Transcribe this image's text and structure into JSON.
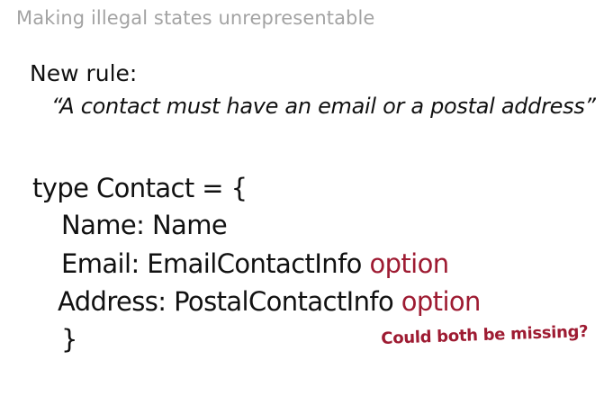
{
  "slide": {
    "title": "Making illegal states unrepresentable",
    "rule_label": "New rule:",
    "rule_text": "“A contact must have an email or a postal address”",
    "code": {
      "line1": "type Contact = {",
      "line2": "Name: Name",
      "line3_main": "Email: EmailContactInfo",
      "line3_kw": "option",
      "line4_main": "Address: PostalContactInfo",
      "line4_kw": "option",
      "line5": "}"
    },
    "annotation": "Could both be missing?",
    "colors": {
      "title": "#a3a3a3",
      "text": "#111111",
      "accent": "#9e1b32"
    }
  }
}
